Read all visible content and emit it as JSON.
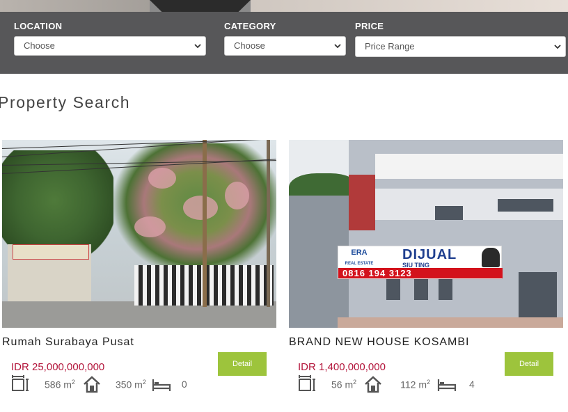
{
  "search": {
    "location": {
      "label": "LOCATION",
      "value": "Choose"
    },
    "category": {
      "label": "CATEGORY",
      "value": "Choose"
    },
    "price": {
      "label": "PRICE",
      "value": "Price Range"
    }
  },
  "section": {
    "title": "Property Search"
  },
  "listings": [
    {
      "title": "Rumah Surabaya Pusat",
      "price": "IDR 25,000,000,000",
      "land_area": "586 m",
      "building_area": "350 m",
      "bedrooms": "0",
      "area_unit_exp": "2",
      "detail_label": "Detail"
    },
    {
      "title": "BRAND NEW HOUSE KOSAMBI",
      "price": "IDR 1,400,000,000",
      "land_area": "56 m",
      "building_area": "112 m",
      "bedrooms": "4",
      "area_unit_exp": "2",
      "detail_label": "Detail",
      "photo_sign": {
        "brand": "ERA",
        "brand_sub": "REAL ESTATE",
        "headline": "DIJUAL",
        "agent": "SIU TING",
        "phone": "0816 194 3123"
      }
    }
  ],
  "colors": {
    "search_bar_bg": "#575759",
    "price_text": "#b3153b",
    "detail_button": "#9dc43c"
  }
}
